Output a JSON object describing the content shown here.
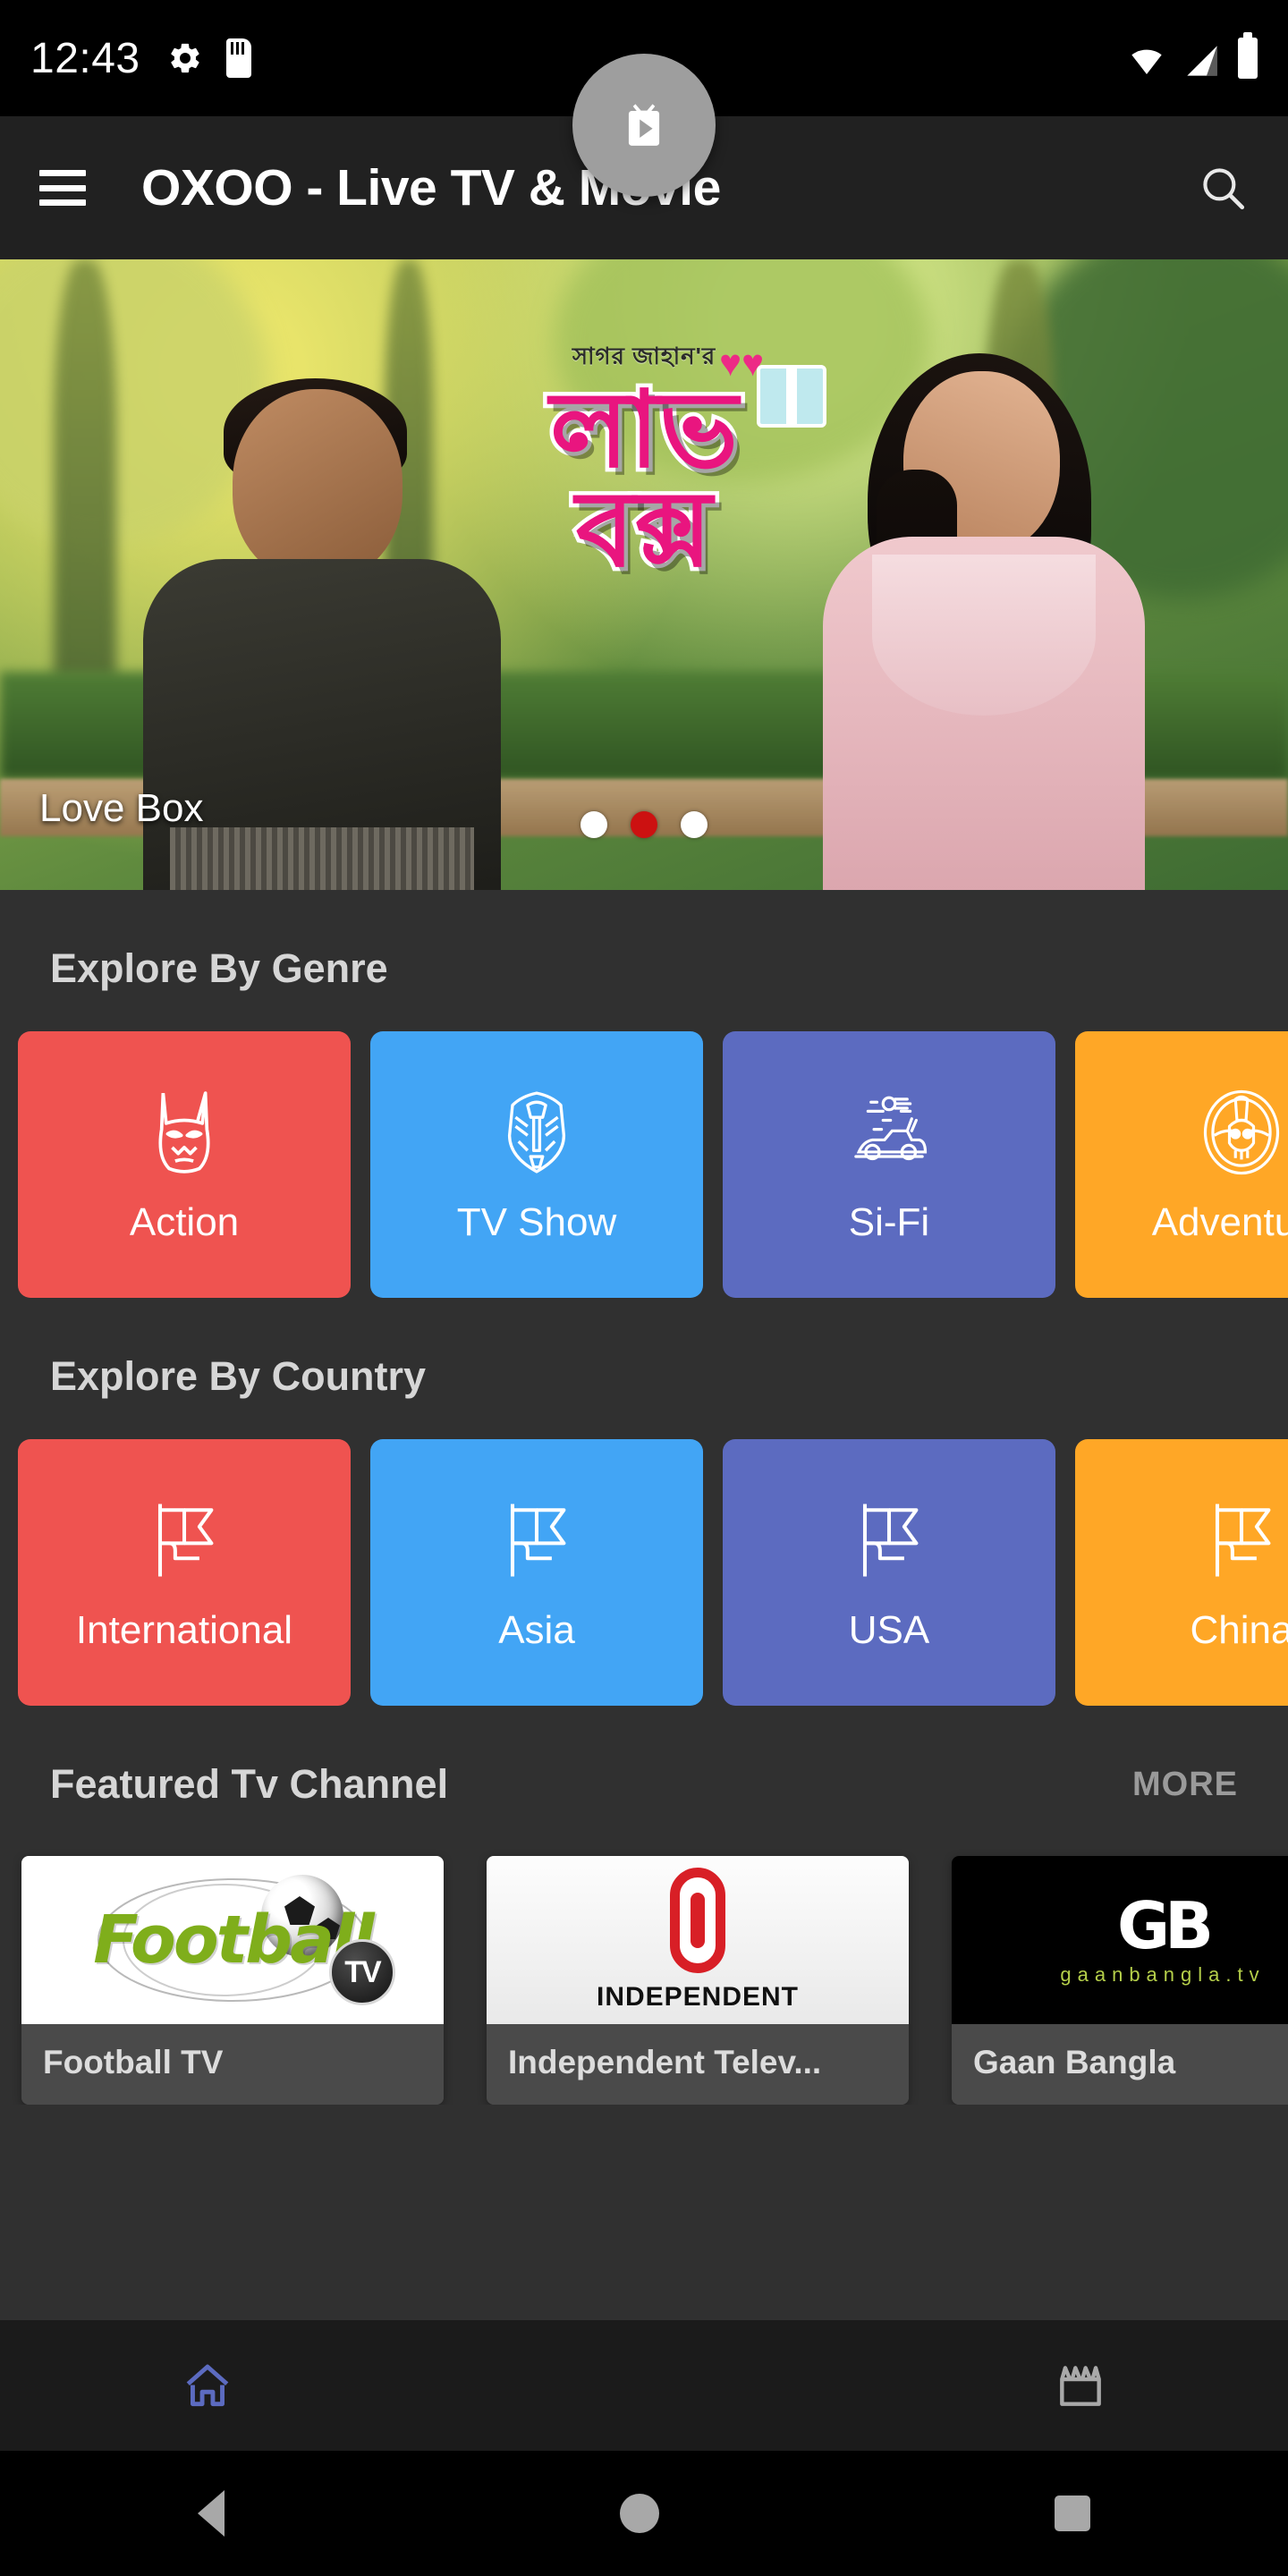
{
  "status_bar": {
    "time": "12:43",
    "left_icons": [
      "gear-icon",
      "sd-card-icon"
    ],
    "right_icons": [
      "wifi-icon",
      "signal-icon",
      "battery-icon"
    ]
  },
  "app_bar": {
    "menu_icon": "hamburger-menu-icon",
    "title": "OXOO - Live TV & Movie",
    "search_icon": "search-icon"
  },
  "banner": {
    "caption": "Love Box",
    "poster_credit": "সাগর জাহান'র",
    "poster_title_line1": "লাভ",
    "poster_title_line2": "বক্স",
    "dots_total": 3,
    "dots_active_index": 1,
    "active_dot_color": "#cc1111",
    "inactive_dot_color": "#ffffff"
  },
  "genre_section": {
    "title": "Explore By Genre",
    "items": [
      {
        "label": "Action",
        "icon": "batman-mask-icon",
        "color": "#EF5350"
      },
      {
        "label": "TV Show",
        "icon": "autobot-icon",
        "color": "#42A5F5"
      },
      {
        "label": "Si-Fi",
        "icon": "delorean-car-icon",
        "color": "#5C6BC0"
      },
      {
        "label": "Adventure",
        "icon": "skull-compass-icon",
        "color": "#FFA726"
      }
    ]
  },
  "country_section": {
    "title": "Explore By Country",
    "items": [
      {
        "label": "International",
        "icon": "flag-icon",
        "color": "#EF5350"
      },
      {
        "label": "Asia",
        "icon": "flag-icon",
        "color": "#42A5F5"
      },
      {
        "label": "USA",
        "icon": "flag-icon",
        "color": "#5C6BC0"
      },
      {
        "label": "China",
        "icon": "flag-icon",
        "color": "#FFA726"
      }
    ]
  },
  "featured_section": {
    "title": "Featured Tv Channel",
    "more_label": "MORE",
    "channels": [
      {
        "name": "Football TV",
        "logo_text": "Football",
        "logo_badge": "TV"
      },
      {
        "name": "Independent Telev...",
        "logo_text": "INDEPENDENT"
      },
      {
        "name": "Gaan Bangla",
        "logo_text": "GB",
        "logo_sub": "gaanbangla.tv"
      }
    ]
  },
  "bottom_nav": {
    "items": [
      {
        "icon": "home-icon",
        "active": true,
        "color": "#5C6BC0"
      },
      {
        "icon": "tv-play-fab-icon",
        "active": false,
        "color": "#9E9E9E"
      },
      {
        "icon": "movie-clapper-icon",
        "active": false,
        "color": "#9E9E9E"
      }
    ]
  },
  "android_nav": {
    "back": "back-triangle-icon",
    "home": "home-circle-icon",
    "recents": "recents-square-icon"
  }
}
